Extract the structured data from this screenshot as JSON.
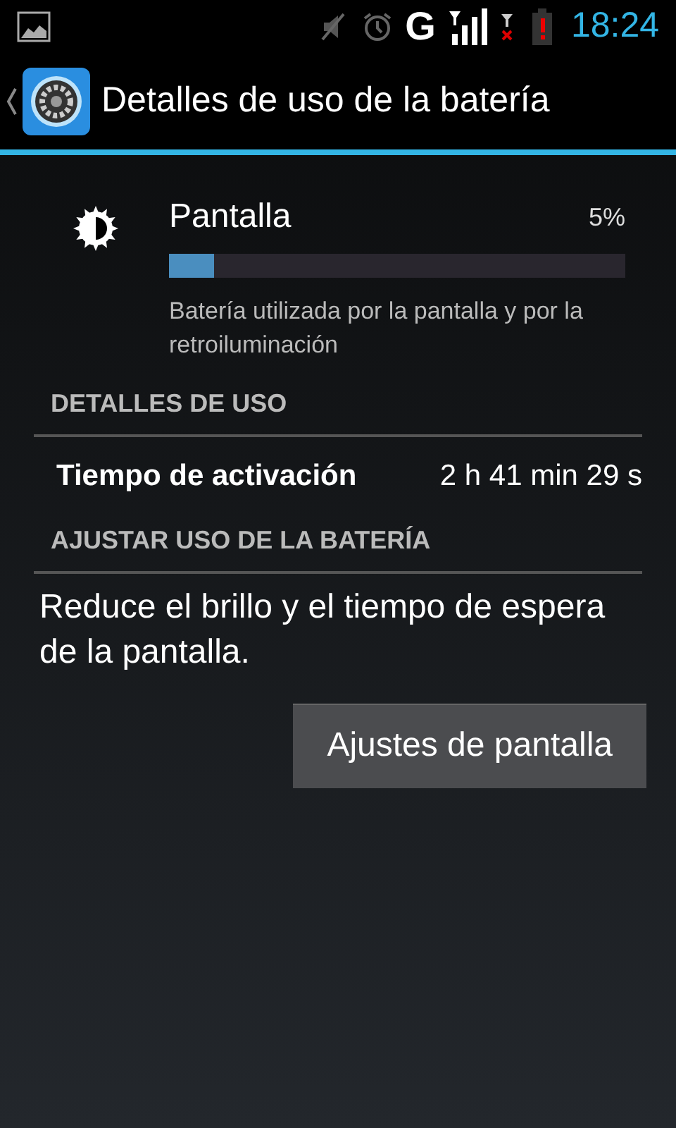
{
  "status_bar": {
    "network": "G",
    "time": "18:24"
  },
  "action_bar": {
    "title": "Detalles de uso de la batería"
  },
  "usage": {
    "name": "Pantalla",
    "percent": "5%",
    "level": 0.1,
    "description": "Batería utilizada por la pantalla y por la retroiluminación"
  },
  "sections": [
    {
      "header": "DETALLES DE USO",
      "kind": "detail",
      "label": "Tiempo de activación",
      "value": "2 h 41 min 29 s"
    },
    {
      "header": "AJUSTAR USO DE LA BATERÍA",
      "kind": "action",
      "text": "Reduce el brillo y el tiempo de espera de la pantalla.",
      "button": "Ajustes de pantalla"
    }
  ]
}
